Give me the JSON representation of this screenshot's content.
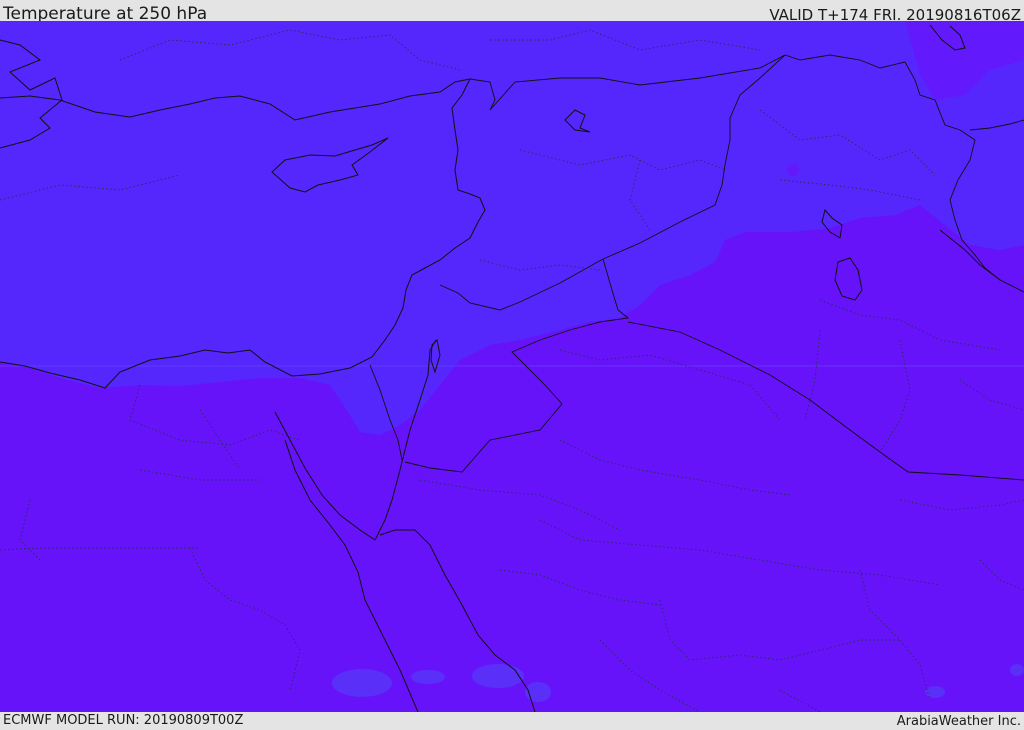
{
  "header": {
    "title": "Temperature at 250 hPa",
    "valid_time": "VALID T+174 FRI. 20190816T06Z"
  },
  "footer": {
    "model_run": "ECMWF MODEL RUN: 20190809T00Z",
    "credit": "ArabiaWeather Inc."
  },
  "colors": {
    "cold_band": "#5627fc",
    "warm_band": "#6713fa",
    "isolated_cool_patch": "#5a30f8",
    "coastline": "#111111",
    "border_dotted": "#2a2a5a"
  }
}
